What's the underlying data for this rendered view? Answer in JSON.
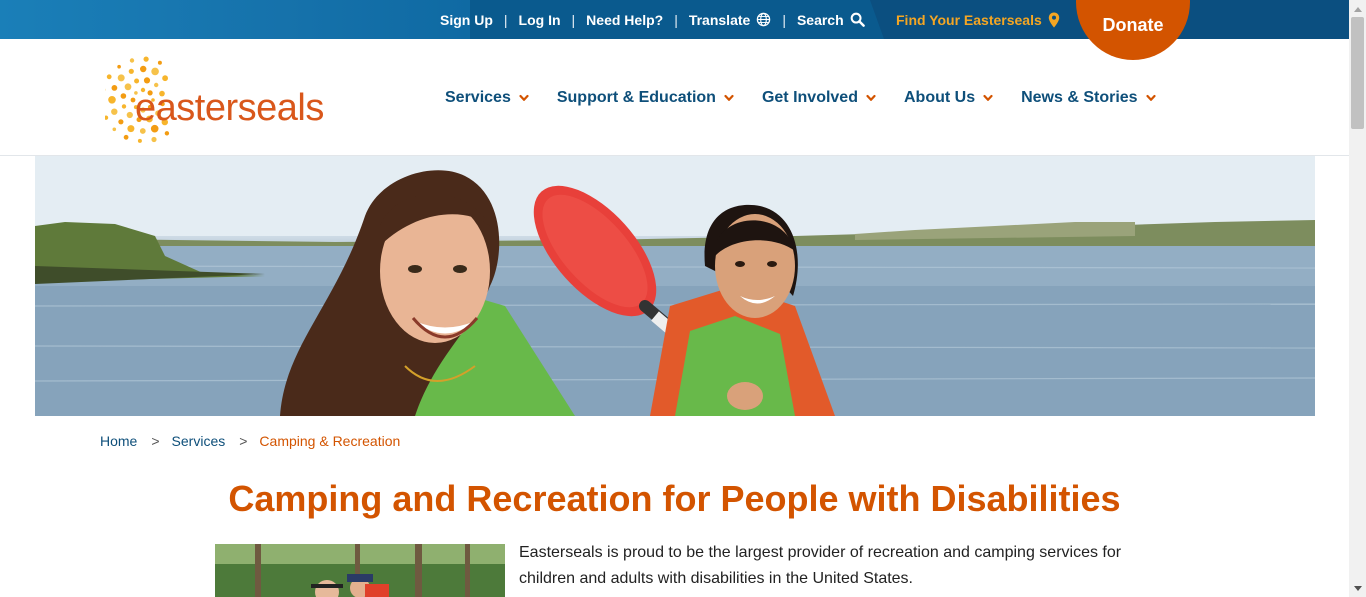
{
  "utility": {
    "links": [
      {
        "label": "Sign Up"
      },
      {
        "label": "Log In"
      },
      {
        "label": "Need Help?"
      },
      {
        "label": "Translate",
        "icon": "globe-icon"
      },
      {
        "label": "Search",
        "icon": "search-icon"
      }
    ],
    "separator": "|",
    "find_label": "Find Your Easterseals",
    "find_icon": "location-pin-icon",
    "donate_label": "Donate"
  },
  "logo": {
    "text": "easterseals",
    "icon": "sunburst-icon"
  },
  "nav": [
    {
      "label": "Services"
    },
    {
      "label": "Support & Education"
    },
    {
      "label": "Get Involved"
    },
    {
      "label": "About Us"
    },
    {
      "label": "News & Stories"
    }
  ],
  "hero": {
    "description_icon": "hero-kayak-photo"
  },
  "breadcrumb": {
    "items": [
      "Home",
      "Services"
    ],
    "current": "Camping & Recreation",
    "separator": ">"
  },
  "page": {
    "title": "Camping and Recreation for People with Disabilities",
    "intro": "Easterseals is proud to be the largest provider of recreation and camping services for children and adults with disabilities in the United States."
  },
  "colors": {
    "brand_orange": "#d35400",
    "navy": "#0e4f7a",
    "topbar": "#0a5a8e",
    "gold": "#f5a623"
  }
}
